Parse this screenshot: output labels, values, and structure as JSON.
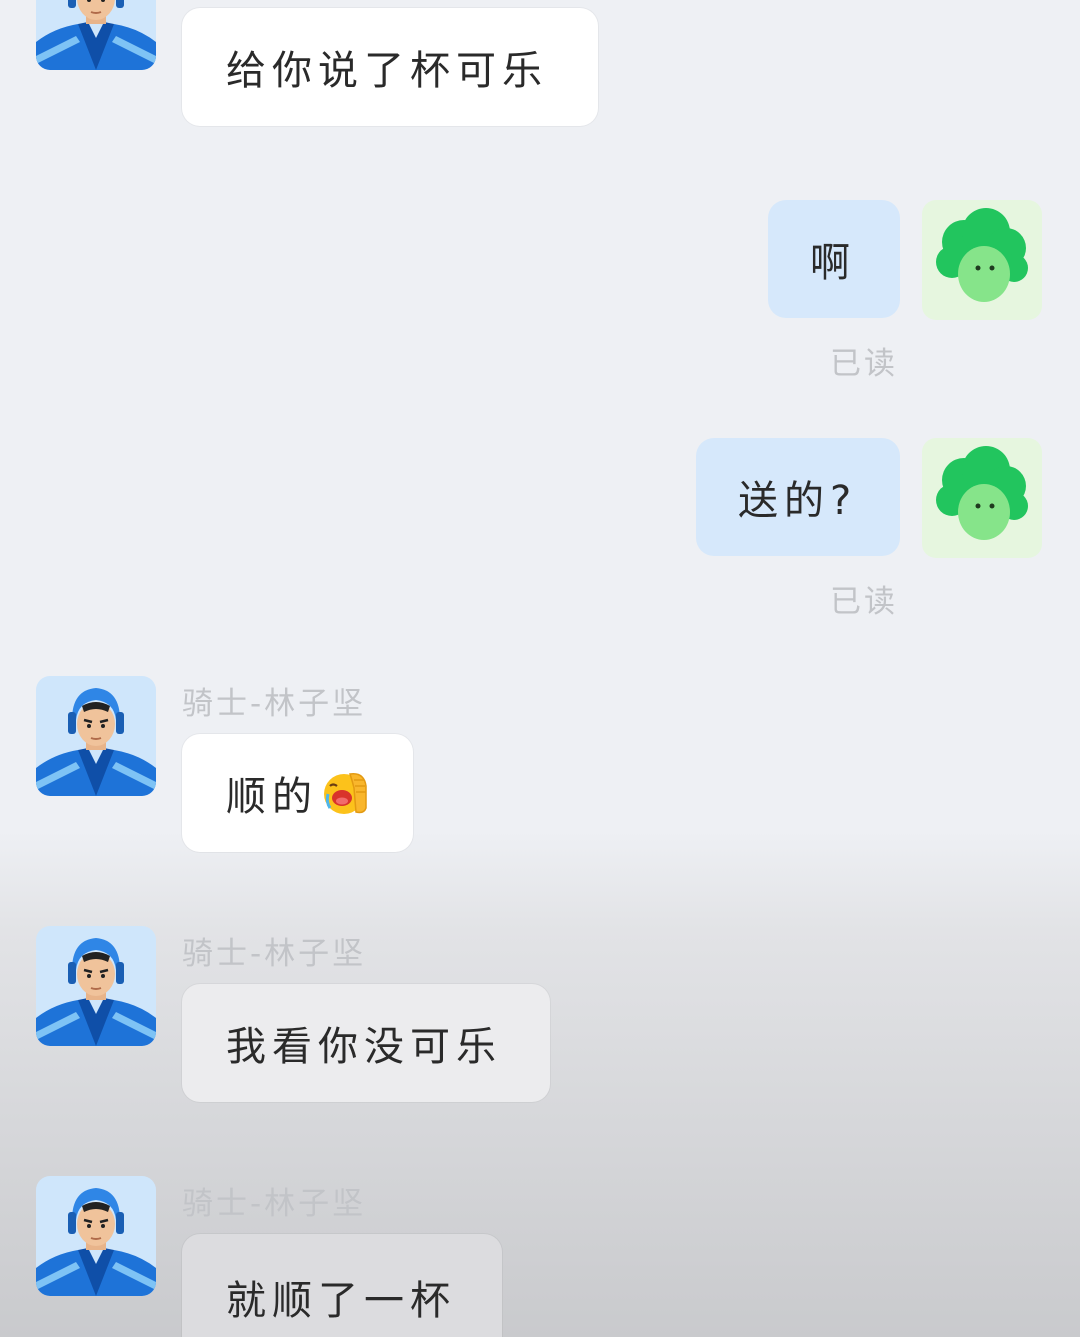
{
  "messages": {
    "m1": {
      "text": "给你说了杯可乐"
    },
    "m2": {
      "text": "啊",
      "status": "已读"
    },
    "m3": {
      "text": "送的?",
      "status": "已读"
    },
    "m4": {
      "sender": "骑士-林子坚",
      "text": "顺的",
      "emoji": "face-palm-crying-emoji"
    },
    "m5": {
      "sender": "骑士-林子坚",
      "text": "我看你没可乐"
    },
    "m6": {
      "sender": "骑士-林子坚",
      "text": "就顺了一杯"
    }
  },
  "icons": {
    "rider_avatar": "rider-avatar-icon",
    "user_avatar": "green-broccoli-avatar-icon"
  },
  "colors": {
    "incoming_bubble": "#ffffff",
    "outgoing_bubble": "#d6e8fb",
    "meta_text": "#c2c4c8",
    "rider_avatar_bg": "#cfe6fb",
    "user_avatar_bg": "#e6f6df",
    "user_avatar_green": "#22c55e"
  }
}
